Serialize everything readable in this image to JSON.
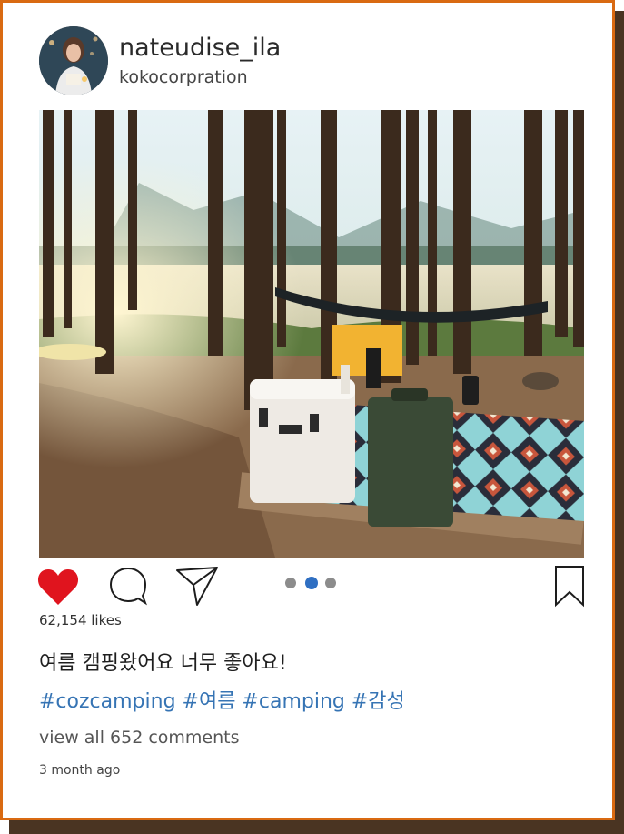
{
  "profile": {
    "username": "nateudise_ila",
    "subtitle": "kokocorpration",
    "avatar_icon": "profile-photo"
  },
  "post": {
    "image_description_icon": "camping-photo",
    "carousel": {
      "total": 3,
      "active": 2
    },
    "likes": "62,154 likes",
    "caption": "여름 캠핑왔어요 너무 좋아요!",
    "hashtags": "#cozcamping #여름 #camping #감성",
    "view_comments": "view all 652 comments",
    "time_ago": "3 month ago",
    "liked": true
  },
  "colors": {
    "frame_border": "#d96a12",
    "frame_shadow": "#4a3422",
    "heart": "#e0141e",
    "hashtag": "#3674b4",
    "dot_active": "#2f6fc2",
    "dot_inactive": "#8c8c8c"
  },
  "icons": {
    "like": "heart-icon",
    "comment": "comment-icon",
    "share": "share-icon",
    "save": "bookmark-icon"
  }
}
